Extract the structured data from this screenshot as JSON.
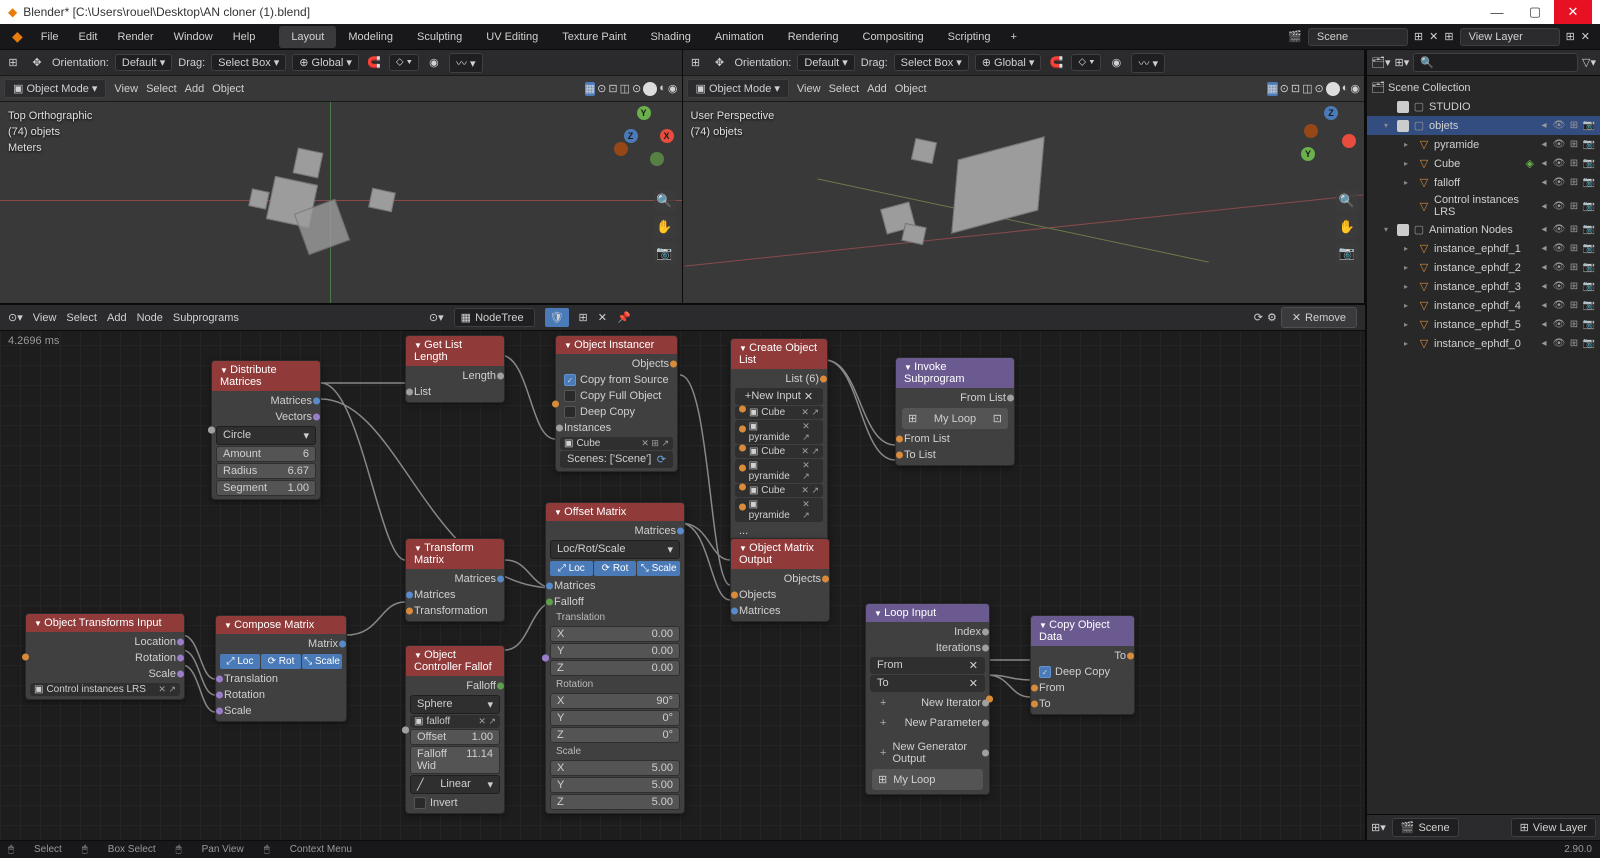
{
  "window_title": "Blender* [C:\\Users\\rouel\\Desktop\\AN cloner (1).blend]",
  "menubar": {
    "items": [
      "File",
      "Edit",
      "Render",
      "Window",
      "Help"
    ],
    "tabs": [
      "Layout",
      "Modeling",
      "Sculpting",
      "UV Editing",
      "Texture Paint",
      "Shading",
      "Animation",
      "Rendering",
      "Compositing",
      "Scripting"
    ],
    "active_tab": "Layout",
    "scene_label": "Scene",
    "viewlayer_label": "View Layer"
  },
  "vp_header": {
    "orientation": "Orientation:",
    "orient_value": "Default",
    "drag": "Drag:",
    "drag_value": "Select Box",
    "transform": "Global"
  },
  "vp_toolbar": {
    "mode": "Object Mode",
    "items": [
      "View",
      "Select",
      "Add",
      "Object"
    ]
  },
  "viewport_left": {
    "ov1": "Top Orthographic",
    "ov2": "(74) objets",
    "ov3": "Meters"
  },
  "viewport_right": {
    "ov1": "User Perspective",
    "ov2": "(74) objets"
  },
  "node_header": {
    "items": [
      "View",
      "Select",
      "Add",
      "Node",
      "Subprograms"
    ],
    "tree": "NodeTree",
    "remove": "Remove",
    "timing": "4.2696 ms"
  },
  "nodes": {
    "distribute": {
      "title": "Distribute Matrices",
      "out1": "Matrices",
      "out2": "Vectors",
      "shape": "Circle",
      "amount_l": "Amount",
      "amount_v": "6",
      "radius_l": "Radius",
      "radius_v": "6.67",
      "segment_l": "Segment",
      "segment_v": "1.00"
    },
    "getlen": {
      "title": "Get List Length",
      "out": "Length",
      "in": "List"
    },
    "transformmat": {
      "title": "Transform Matrix",
      "out": "Matrices",
      "in1": "Matrices",
      "in2": "Transformation"
    },
    "objtransinput": {
      "title": "Object Transforms Input",
      "out1": "Location",
      "out2": "Rotation",
      "out3": "Scale",
      "obj": "Control instances LRS"
    },
    "composemat": {
      "title": "Compose Matrix",
      "out": "Matrix",
      "loc": "Loc",
      "rot": "Rot",
      "scale": "Scale",
      "in1": "Translation",
      "in2": "Rotation",
      "in3": "Scale"
    },
    "objctrlfalloff": {
      "title": "Object Controller Fallof",
      "out": "Falloff",
      "shape": "Sphere",
      "obj": "falloff",
      "offset_l": "Offset",
      "offset_v": "1.00",
      "width_l": "Falloff Wid",
      "width_v": "11.14",
      "interp": "Linear",
      "invert": "Invert"
    },
    "instancer": {
      "title": "Object Instancer",
      "out": "Objects",
      "copy_src": "Copy from Source",
      "copy_full": "Copy Full Object",
      "deep": "Deep Copy",
      "in1": "Instances",
      "obj": "Cube",
      "scenes": "Scenes: ['Scene']"
    },
    "offsetmat": {
      "title": "Offset Matrix",
      "out": "Matrices",
      "mode": "Loc/Rot/Scale",
      "loc": "Loc",
      "rot": "Rot",
      "scale": "Scale",
      "in1": "Matrices",
      "in2": "Falloff",
      "trans_h": "Translation",
      "rot_h": "Rotation",
      "scale_h": "Scale",
      "x": "X",
      "y": "Y",
      "z": "Z",
      "t_x": "0.00",
      "t_y": "0.00",
      "t_z": "0.00",
      "r_x": "90°",
      "r_y": "0°",
      "r_z": "0°",
      "s_x": "5.00",
      "s_y": "5.00",
      "s_z": "5.00"
    },
    "createlist": {
      "title": "Create Object List",
      "out": "List (6)",
      "newinput": "New Input",
      "items": [
        "Cube",
        "pyramide",
        "Cube",
        "pyramide",
        "Cube",
        "pyramide"
      ]
    },
    "objmatout": {
      "title": "Object Matrix Output",
      "out": "Objects",
      "in1": "Objects",
      "in2": "Matrices"
    },
    "invokesub": {
      "title": "Invoke Subprogram",
      "out": "From List",
      "loop": "My Loop",
      "in1": "From List",
      "in2": "To List"
    },
    "loopinput": {
      "title": "Loop Input",
      "out1": "Index",
      "out2": "Iterations",
      "from": "From",
      "to": "To",
      "newiter": "New Iterator",
      "newparam": "New Parameter",
      "newgen": "New Generator Output",
      "name": "My Loop"
    },
    "copyobj": {
      "title": "Copy Object Data",
      "out": "To",
      "deep": "Deep Copy",
      "in1": "From",
      "in2": "To"
    }
  },
  "outliner": {
    "collection": "Scene Collection",
    "rows": [
      {
        "indent": 10,
        "arrow": "",
        "icon": "▢",
        "name": "STUDIO",
        "flags": [
          "",
          "",
          ""
        ]
      },
      {
        "indent": 10,
        "arrow": "▾",
        "icon": "▢",
        "name": "objets",
        "active": true,
        "flags": [
          "◂",
          "👁",
          "⊞",
          "📷"
        ]
      },
      {
        "indent": 30,
        "arrow": "▸",
        "icon": "▽",
        "name": "pyramide",
        "color": "#d98b3a",
        "flags": [
          "◂",
          "👁",
          "⊞",
          "📷"
        ]
      },
      {
        "indent": 30,
        "arrow": "▸",
        "icon": "▽",
        "name": "Cube",
        "color": "#d98b3a",
        "extra": "◈",
        "flags": [
          "◂",
          "👁",
          "⊞",
          "📷"
        ]
      },
      {
        "indent": 30,
        "arrow": "▸",
        "icon": "▽",
        "name": "falloff",
        "color": "#d98b3a",
        "flags": [
          "◂",
          "👁",
          "⊞",
          "📷"
        ]
      },
      {
        "indent": 30,
        "arrow": "",
        "icon": "▽",
        "name": "Control instances LRS",
        "color": "#d98b3a",
        "flags": [
          "◂",
          "👁",
          "⊞",
          "📷"
        ]
      },
      {
        "indent": 10,
        "arrow": "▾",
        "icon": "▢",
        "name": "Animation Nodes",
        "flags": [
          "◂",
          "👁",
          "⊞",
          "📷"
        ]
      },
      {
        "indent": 30,
        "arrow": "▸",
        "icon": "▽",
        "name": "instance_ephdf_1",
        "color": "#d98b3a",
        "flags": [
          "◂",
          "👁",
          "⊞",
          "📷"
        ]
      },
      {
        "indent": 30,
        "arrow": "▸",
        "icon": "▽",
        "name": "instance_ephdf_2",
        "color": "#d98b3a",
        "flags": [
          "◂",
          "👁",
          "⊞",
          "📷"
        ]
      },
      {
        "indent": 30,
        "arrow": "▸",
        "icon": "▽",
        "name": "instance_ephdf_3",
        "color": "#d98b3a",
        "flags": [
          "◂",
          "👁",
          "⊞",
          "📷"
        ]
      },
      {
        "indent": 30,
        "arrow": "▸",
        "icon": "▽",
        "name": "instance_ephdf_4",
        "color": "#d98b3a",
        "flags": [
          "◂",
          "👁",
          "⊞",
          "📷"
        ]
      },
      {
        "indent": 30,
        "arrow": "▸",
        "icon": "▽",
        "name": "instance_ephdf_5",
        "color": "#d98b3a",
        "flags": [
          "◂",
          "👁",
          "⊞",
          "📷"
        ]
      },
      {
        "indent": 30,
        "arrow": "▸",
        "icon": "▽",
        "name": "instance_ephdf_0",
        "color": "#d98b3a",
        "flags": [
          "◂",
          "👁",
          "⊞",
          "📷"
        ]
      }
    ],
    "footer_scene": "Scene",
    "footer_layer": "View Layer"
  },
  "statusbar": {
    "items": [
      "Select",
      "Box Select",
      "Pan View",
      "Context Menu"
    ],
    "version": "2.90.0"
  }
}
